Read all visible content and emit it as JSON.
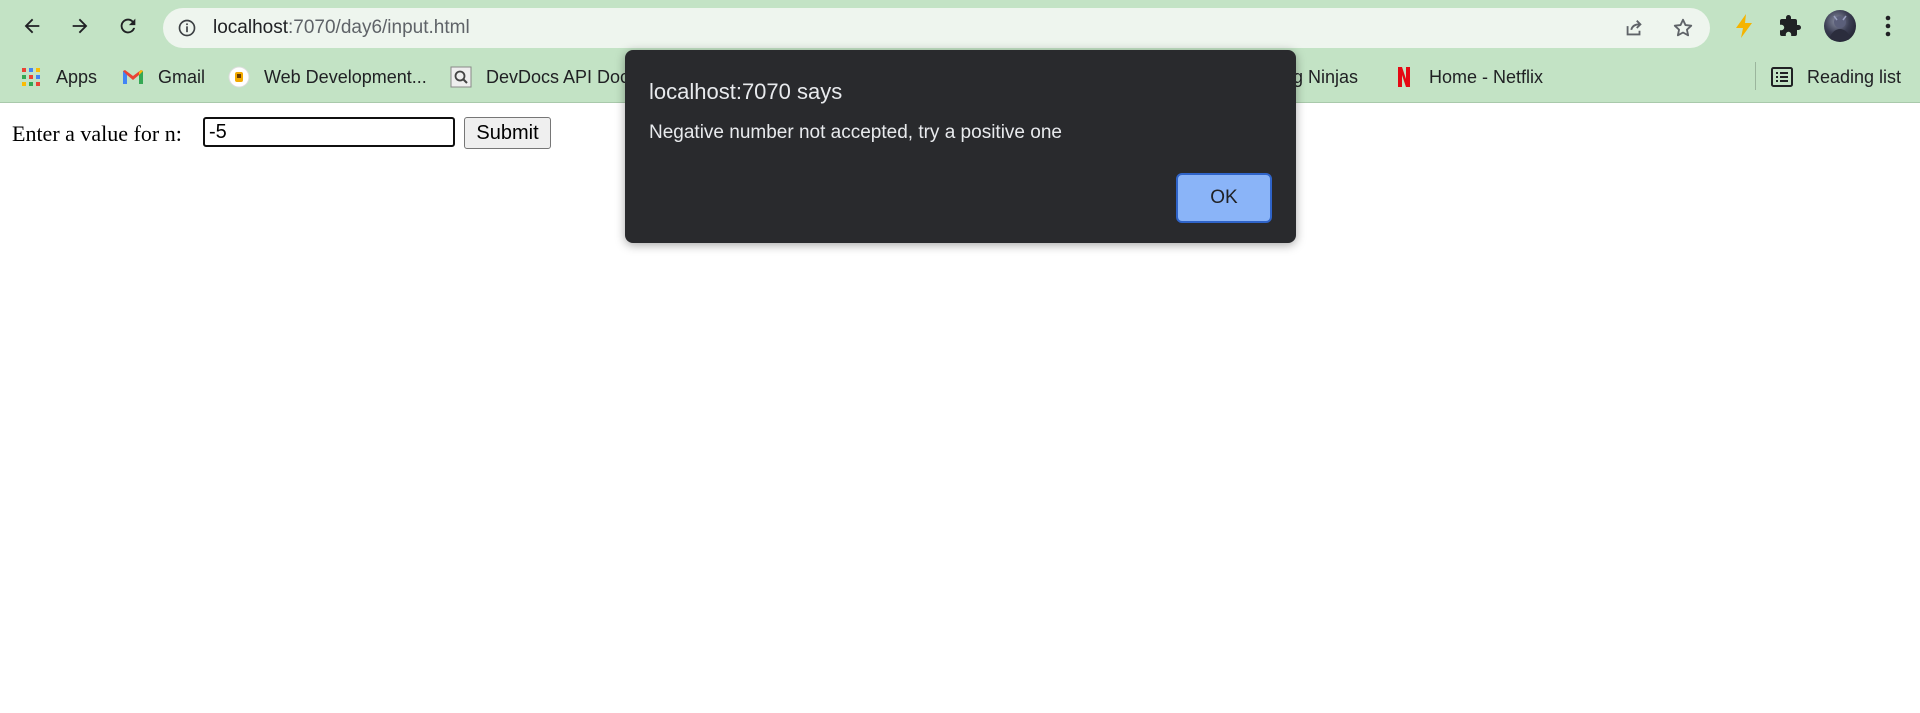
{
  "browser": {
    "url_host": "localhost",
    "url_path": ":7070/day6/input.html",
    "icons": [
      "back-icon",
      "forward-icon",
      "reload-icon",
      "site-info-icon",
      "share-icon",
      "bookmark-star-icon",
      "extension-bolt-icon",
      "extensions-puzzle-icon",
      "profile-avatar",
      "kebab-menu-icon"
    ]
  },
  "bookmarks": {
    "items": [
      {
        "label": "Apps",
        "icon": "apps-grid-icon"
      },
      {
        "label": "Gmail",
        "icon": "gmail-icon"
      },
      {
        "label": "Web Development...",
        "icon": "web-dev-icon"
      },
      {
        "label": "DevDocs API Doc",
        "icon": "devdocs-icon"
      },
      {
        "label": "ng Ninjas",
        "icon": ""
      },
      {
        "label": "Home - Netflix",
        "icon": "netflix-icon"
      }
    ],
    "reading_list": "Reading list"
  },
  "page": {
    "form_label": "Enter a value for n:",
    "input_value": "-5",
    "submit_label": "Submit"
  },
  "dialog": {
    "title": "localhost:7070 says",
    "message": "Negative number not accepted, try a positive one",
    "ok_label": "OK"
  },
  "colors": {
    "frame": "#c3e3c5",
    "dialog_bg": "#292a2d",
    "ok_button": "#8ab4f8",
    "netflix": "#e50914"
  }
}
